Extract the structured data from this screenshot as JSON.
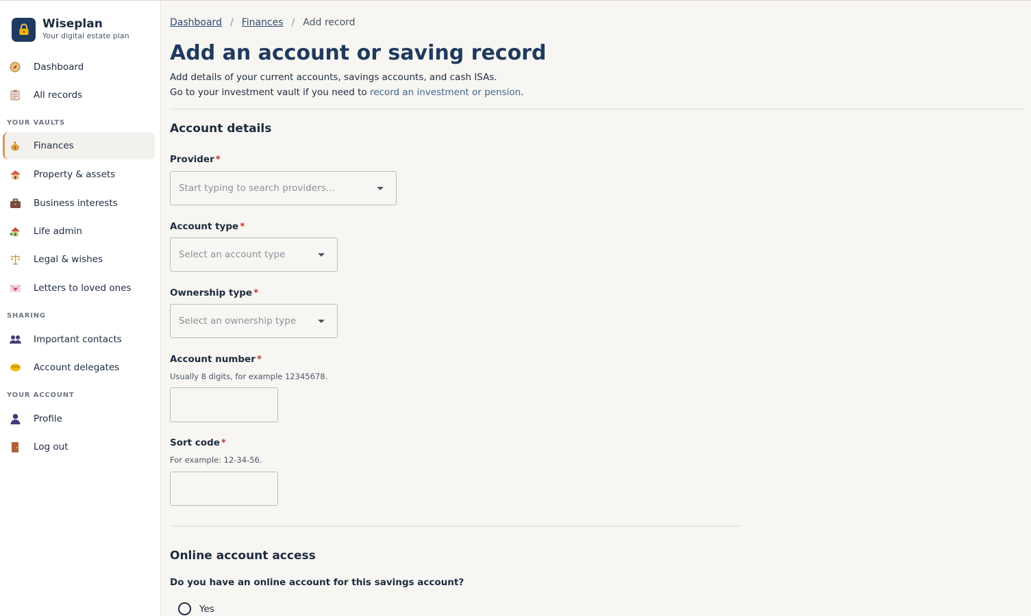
{
  "app": {
    "name": "Wiseplan",
    "tagline": "Your digital estate plan"
  },
  "sidebar": {
    "top_items": [
      {
        "label": "Dashboard",
        "icon": "compass-icon"
      },
      {
        "label": "All records",
        "icon": "clipboard-icon"
      }
    ],
    "vaults_heading": "YOUR VAULTS",
    "vault_items": [
      {
        "label": "Finances",
        "icon": "money-bag-icon",
        "active": true
      },
      {
        "label": "Property & assets",
        "icon": "house-icon"
      },
      {
        "label": "Business interests",
        "icon": "briefcase-icon"
      },
      {
        "label": "Life admin",
        "icon": "house-garden-icon"
      },
      {
        "label": "Legal & wishes",
        "icon": "scales-icon"
      },
      {
        "label": "Letters to loved ones",
        "icon": "love-letter-icon"
      }
    ],
    "sharing_heading": "SHARING",
    "sharing_items": [
      {
        "label": "Important contacts",
        "icon": "people-icon"
      },
      {
        "label": "Account delegates",
        "icon": "handshake-icon"
      }
    ],
    "account_heading": "YOUR ACCOUNT",
    "account_items": [
      {
        "label": "Profile",
        "icon": "person-icon"
      },
      {
        "label": "Log out",
        "icon": "door-icon"
      }
    ]
  },
  "breadcrumb": {
    "items": [
      "Dashboard",
      "Finances"
    ],
    "separator": "/",
    "current": "Add record"
  },
  "page": {
    "title": "Add an account or saving record",
    "intro_line1": "Add details of your current accounts, savings accounts, and cash ISAs.",
    "intro_line2_prefix": "Go to your investment vault if you need to ",
    "intro_link": "record an investment or pension",
    "intro_line2_suffix": "."
  },
  "form": {
    "account_details_title": "Account details",
    "required_marker": "*",
    "provider": {
      "label": "Provider",
      "placeholder": "Start typing to search providers..."
    },
    "account_type": {
      "label": "Account type",
      "placeholder": "Select an account type"
    },
    "ownership_type": {
      "label": "Ownership type",
      "placeholder": "Select an ownership type"
    },
    "account_number": {
      "label": "Account number",
      "hint": "Usually 8 digits, for example 12345678.",
      "value": ""
    },
    "sort_code": {
      "label": "Sort code",
      "hint": "For example: 12-34-56.",
      "value": ""
    },
    "online_access_title": "Online account access",
    "online_question": "Do you have an online account for this savings account?",
    "online_options": [
      "Yes"
    ]
  },
  "colors": {
    "brand": "#1f3a5f",
    "active_accent": "#d29a61",
    "link": "#3d6491",
    "required": "#c0392b",
    "background": "#f8f6f2"
  }
}
